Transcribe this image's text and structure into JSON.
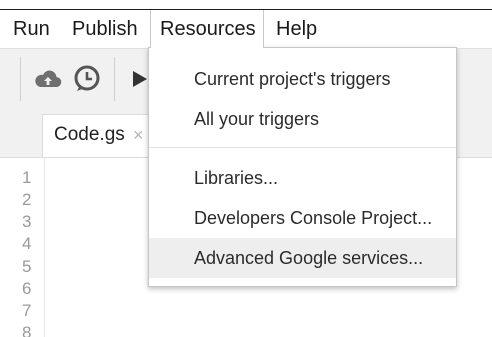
{
  "menubar": {
    "items": [
      {
        "label": "Run"
      },
      {
        "label": "Publish"
      },
      {
        "label": "Resources"
      },
      {
        "label": "Help"
      }
    ],
    "active": "Resources"
  },
  "toolbar": {
    "icons": [
      "cloud-upload-icon",
      "clock-icon",
      "play-icon"
    ]
  },
  "tabs": [
    {
      "label": "Code.gs",
      "close": "×"
    }
  ],
  "editor": {
    "line_numbers": [
      "1",
      "2",
      "3",
      "4",
      "5",
      "6",
      "7",
      "8"
    ]
  },
  "dropdown": {
    "items": [
      {
        "label": "Current project's triggers"
      },
      {
        "label": "All your triggers"
      },
      {
        "label": "Libraries..."
      },
      {
        "label": "Developers Console Project..."
      },
      {
        "label": "Advanced Google services...",
        "highlighted": true
      }
    ]
  },
  "colors": {
    "toolbar_bg": "#f1f1f1",
    "highlight_bg": "#eeeeee",
    "icon_gray": "#6f6f6f"
  }
}
